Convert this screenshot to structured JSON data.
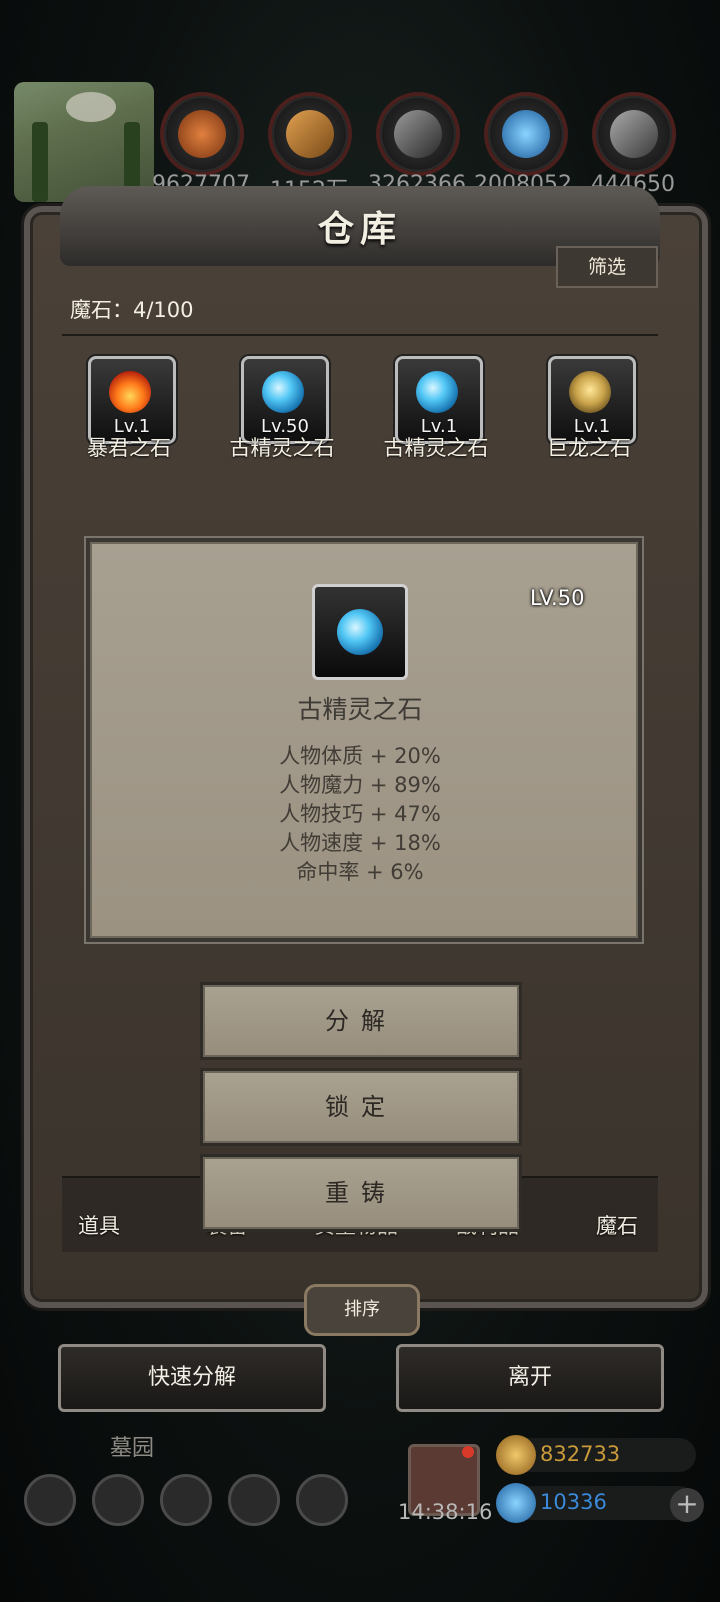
{
  "resources": [
    {
      "icon": "leather-icon",
      "value": "9627707",
      "color": "#c0642a"
    },
    {
      "icon": "wood-icon",
      "value": "1152万",
      "color": "#c98a3a"
    },
    {
      "icon": "stone-icon",
      "value": "3262366",
      "color": "#8a8a8a"
    },
    {
      "icon": "crystal-icon",
      "value": "2008052",
      "color": "#3aa0e8"
    },
    {
      "icon": "iron-icon",
      "value": "444650",
      "color": "#9a9a9a"
    }
  ],
  "warehouse": {
    "title": "仓库",
    "filter_label": "筛选",
    "count_label": "魔石：4/100"
  },
  "stones": [
    {
      "name": "暴君之石",
      "level": "Lv.1",
      "gem": "fire"
    },
    {
      "name": "古精灵之石",
      "level": "Lv.50",
      "gem": "blue"
    },
    {
      "name": "古精灵之石",
      "level": "Lv.1",
      "gem": "blue"
    },
    {
      "name": "巨龙之石",
      "level": "Lv.1",
      "gem": "gold"
    }
  ],
  "detail": {
    "level": "LV.50",
    "name": "古精灵之石",
    "stats": [
      "人物体质 + 20%",
      "人物魔力 + 89%",
      "人物技巧 + 47%",
      "人物速度 + 18%",
      "命中率 + 6%"
    ]
  },
  "actions": {
    "decompose": "分解",
    "lock": "锁定",
    "reforge": "重铸"
  },
  "tabs": [
    {
      "label": "道具"
    },
    {
      "label": "装备"
    },
    {
      "label": "贵重物品"
    },
    {
      "label": "战利品"
    },
    {
      "label": "魔石"
    }
  ],
  "sort_label": "排序",
  "quick_decompose": "快速分解",
  "leave": "离开",
  "hud": {
    "zone": "墓园",
    "time": "14:38:16",
    "gold": "832733",
    "gems": "10336",
    "gold_color": "#c89a3a",
    "gem_color": "#3a8ad8"
  }
}
